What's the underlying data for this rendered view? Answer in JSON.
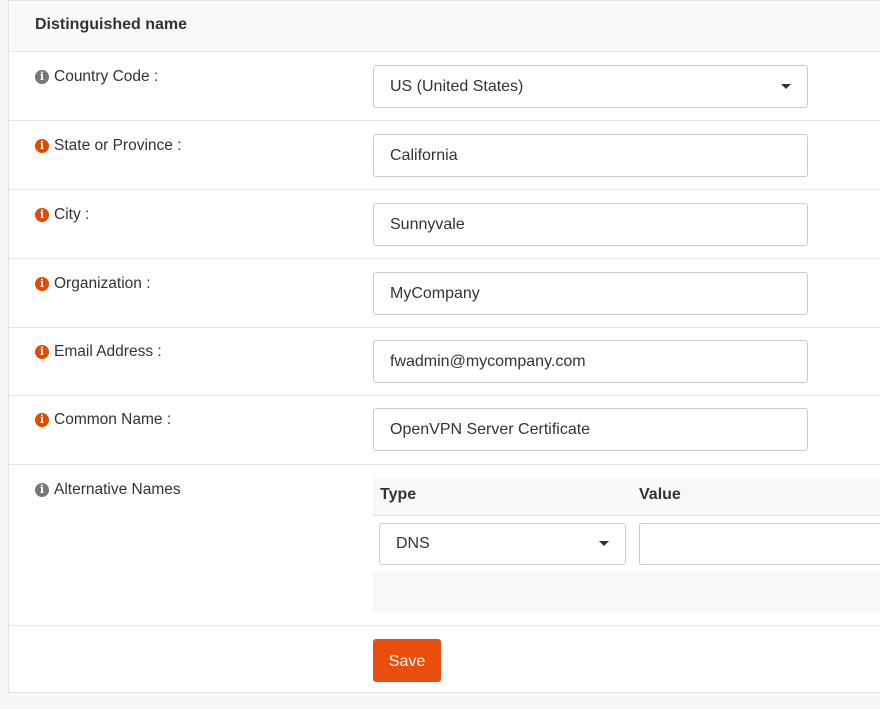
{
  "section": {
    "title": "Distinguished name"
  },
  "fields": {
    "country_code": {
      "label": "Country Code :",
      "value": "US (United States)"
    },
    "state": {
      "label": "State or Province :",
      "value": "California"
    },
    "city": {
      "label": "City :",
      "value": "Sunnyvale"
    },
    "organization": {
      "label": "Organization :",
      "value": "MyCompany"
    },
    "email": {
      "label": "Email Address :",
      "value": "fwadmin@mycompany.com"
    },
    "common_name": {
      "label": "Common Name :",
      "value": "OpenVPN Server Certificate"
    },
    "alt_names": {
      "label": "Alternative Names",
      "type_header": "Type",
      "value_header": "Value",
      "type_value": "DNS",
      "value_value": ""
    }
  },
  "icons": {
    "info_required": "info-circle-icon",
    "info_optional": "info-circle-icon"
  },
  "colors": {
    "required": "#e34a00",
    "optional": "#777777",
    "save": "#e94e0f"
  },
  "actions": {
    "save_label": "Save"
  }
}
